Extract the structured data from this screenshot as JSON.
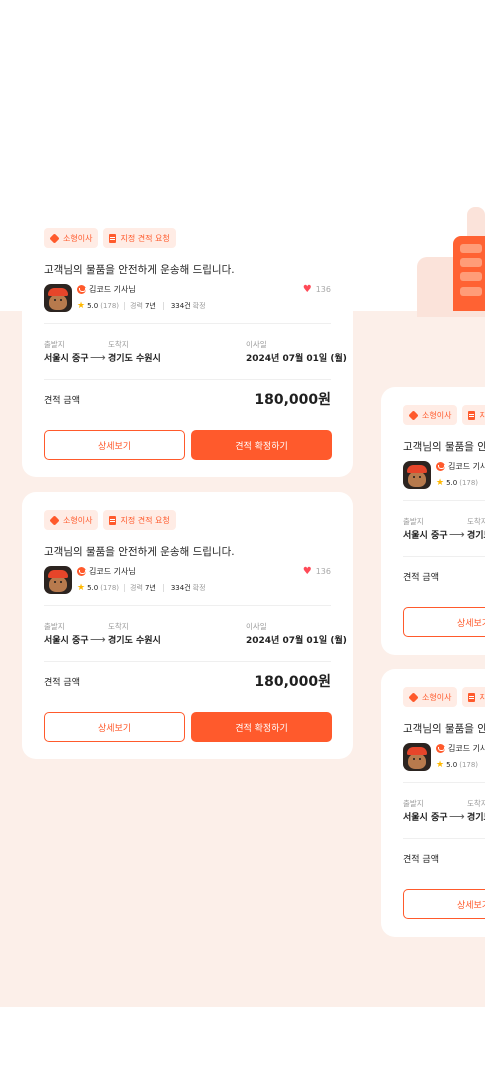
{
  "quotes": [
    {
      "tags": [
        "소형이사",
        "지정 견적 요청"
      ],
      "message": "고객님의 물품을 안전하게 운송해 드립니다.",
      "driver": {
        "name": "김코드 기사님",
        "rating": "5.0",
        "reviews": "(178)",
        "career_label": "경력",
        "career_value": "7년",
        "confirmed_value": "334건",
        "confirmed_label": "확정"
      },
      "likes": "136",
      "route": {
        "from_label": "출발지",
        "from": "서울시 중구",
        "to_label": "도착지",
        "to": "경기도 수원시",
        "date_label": "이사일",
        "date": "2024년 07월 01일 (월)"
      },
      "price_label": "견적 금액",
      "price": "180,000원",
      "detail_button": "상세보기",
      "confirm_button": "견적 확정하기"
    },
    {
      "tags": [
        "소형이사",
        "지정 견적 요청"
      ],
      "message": "고객님의 물품을 안전하게 운송해 드립니다.",
      "driver": {
        "name": "김코드 기사님",
        "rating": "5.0",
        "reviews": "(178)",
        "career_label": "경력",
        "career_value": "7년",
        "confirmed_value": "334건",
        "confirmed_label": "확정"
      },
      "likes": "136",
      "route": {
        "from_label": "출발지",
        "from": "서울시 중구",
        "to_label": "도착지",
        "to": "경기도 수원시",
        "date_label": "이사일",
        "date": "2024년 07월 01일 (월)"
      },
      "price_label": "견적 금액",
      "price": "180,000원",
      "detail_button": "상세보기",
      "confirm_button": "견적 확정하기"
    }
  ],
  "side_quotes": [
    {
      "tag1": "소형이사",
      "tag2": "지정",
      "message": "고객님의 물품을 안전",
      "driver_name": "김코드 기사",
      "rating": "5.0",
      "reviews": "(178)",
      "from_label": "출발지",
      "to_label": "도착지",
      "from": "서울시 중구",
      "to": "경기도",
      "price_label": "견적 금액",
      "detail_button": "상세보기"
    },
    {
      "tag1": "소형이사",
      "tag2": "지정",
      "message": "고객님의 물품을 안전",
      "driver_name": "김코드 기사",
      "rating": "5.0",
      "reviews": "(178)",
      "from_label": "출발지",
      "to_label": "도착지",
      "from": "서울시 중구",
      "to": "경기도",
      "price_label": "견적 금액",
      "detail_button": "상세보기"
    }
  ],
  "colors": {
    "accent": "#ff5a2c",
    "background_band": "#fcefe9",
    "tag_bg": "#ffece5",
    "heart": "#ff4a57",
    "star": "#ffb800"
  },
  "icons": {
    "tag_moving": "box-icon",
    "tag_request": "document-icon",
    "driver_badge": "driver-badge-icon",
    "rating": "star-icon",
    "like": "heart-icon",
    "route": "arrow-right-icon"
  }
}
